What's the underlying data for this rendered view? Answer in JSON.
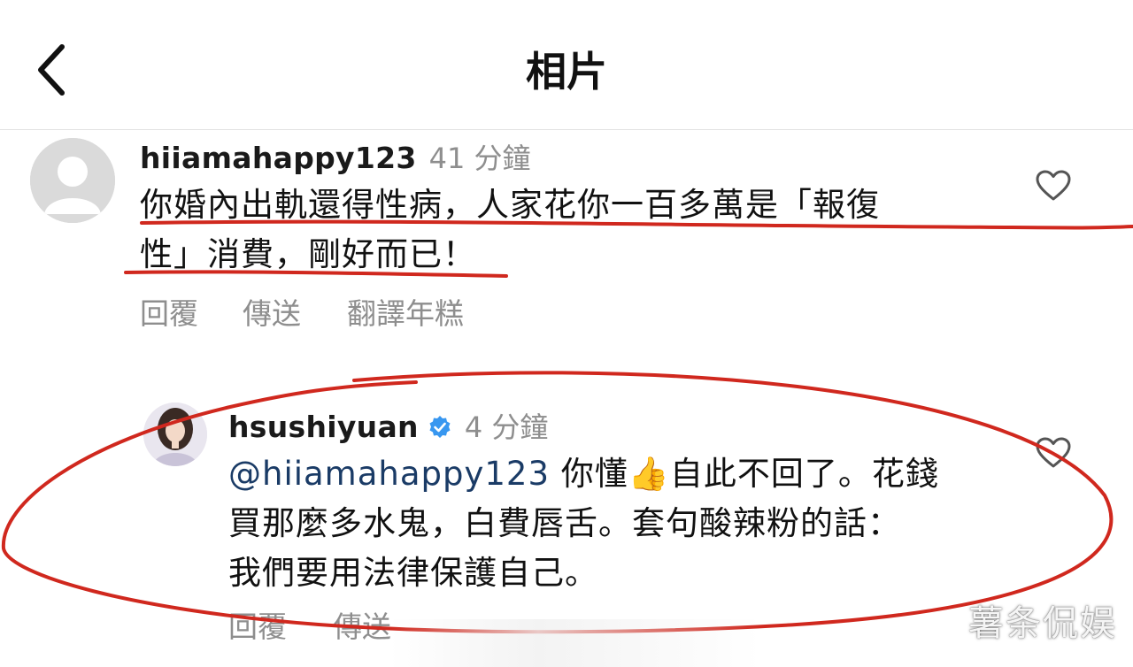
{
  "header": {
    "title": "相片",
    "back_icon": "chevron-left-icon"
  },
  "comments": [
    {
      "username": "hiiamahappy123",
      "time": "41 分鐘",
      "line1": "你婚內出軌還得性病，人家花你一百多萬是「報復",
      "line2": "性」消費，剛好而已！",
      "actions": [
        "回覆",
        "傳送",
        "翻譯年糕"
      ],
      "avatar": "default-avatar-icon",
      "like_icon": "heart-outline-icon"
    },
    {
      "username": "hsushiyuan",
      "verified": true,
      "time": "4 分鐘",
      "mention": "@hiiamahappy123",
      "line1_rest": " 你懂",
      "emoji": "👍",
      "line1_tail": "自此不回了。花錢",
      "line2": "買那麼多水鬼，白費唇舌。套句酸辣粉的話：",
      "line3": "我們要用法律保護自己。",
      "actions": [
        "回覆",
        "傳送"
      ],
      "avatar": "profile-photo-avatar",
      "like_icon": "heart-outline-icon"
    }
  ],
  "annotation_color": "#d0281e",
  "watermark": "薯条侃娱"
}
